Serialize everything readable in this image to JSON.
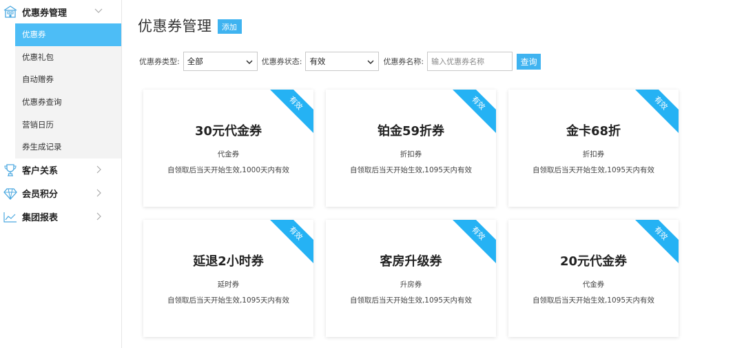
{
  "sidebar": {
    "groups": [
      {
        "label": "优惠券管理",
        "icon": "building-icon",
        "expanded": true
      },
      {
        "label": "客户关系",
        "icon": "trophy-icon"
      },
      {
        "label": "会员积分",
        "icon": "diamond-icon"
      },
      {
        "label": "集团报表",
        "icon": "line-chart-icon"
      }
    ],
    "sub_items": [
      {
        "label": "优惠券",
        "active": true
      },
      {
        "label": "优惠礼包"
      },
      {
        "label": "自动赠券"
      },
      {
        "label": "优惠券查询"
      },
      {
        "label": "营销日历"
      },
      {
        "label": "券生成记录"
      }
    ]
  },
  "header": {
    "title": "优惠券管理",
    "add_label": "添加"
  },
  "filters": {
    "type_label": "优惠券类型:",
    "type_value": "全部",
    "status_label": "优惠券状态:",
    "status_value": "有效",
    "name_label": "优惠券名称:",
    "name_placeholder": "输入优惠券名称",
    "query_label": "查询"
  },
  "cards": [
    {
      "name": "30元代金券",
      "type": "代金券",
      "rule": "自领取后当天开始生效,1000天内有效",
      "badge": "有效"
    },
    {
      "name": "铂金59折券",
      "type": "折扣券",
      "rule": "自领取后当天开始生效,1095天内有效",
      "badge": "有效"
    },
    {
      "name": "金卡68折",
      "type": "折扣券",
      "rule": "自领取后当天开始生效,1095天内有效",
      "badge": "有效"
    },
    {
      "name": "延退2小时券",
      "type": "延时券",
      "rule": "自领取后当天开始生效,1095天内有效",
      "badge": "有效"
    },
    {
      "name": "客房升级券",
      "type": "升房券",
      "rule": "自领取后当天开始生效,1095天内有效",
      "badge": "有效"
    },
    {
      "name": "20元代金券",
      "type": "代金券",
      "rule": "自领取后当天开始生效,1095天内有效",
      "badge": "有效"
    }
  ],
  "colors": {
    "accent": "#4dbdf6",
    "ribbon": "#25b2f4",
    "button": "#3fb3f0",
    "submenu_bg": "#f3f3f3"
  }
}
